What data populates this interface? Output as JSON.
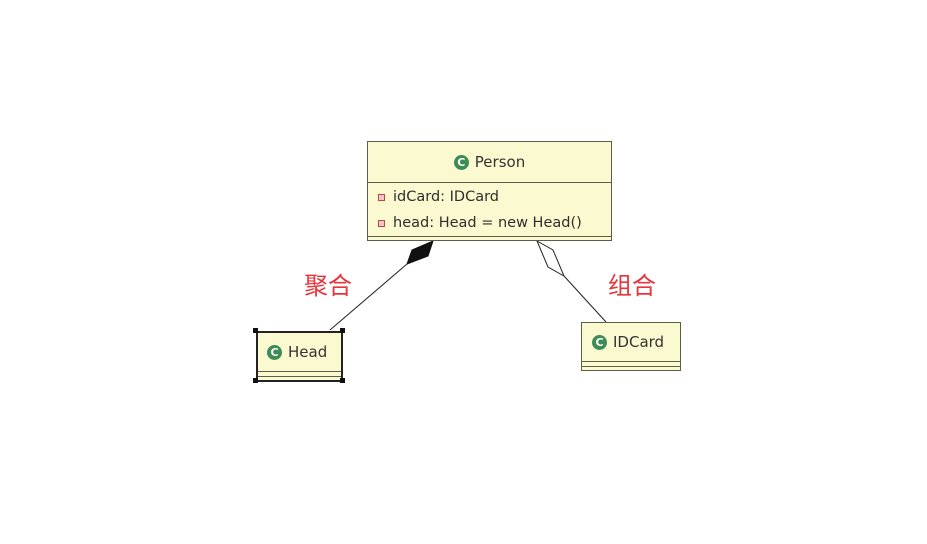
{
  "diagram": {
    "classes": {
      "person": {
        "name": "Person",
        "icon": "class-icon",
        "attributes": [
          {
            "text": "idCard: IDCard",
            "icon": "private-field-icon"
          },
          {
            "text": "head: Head = new Head()",
            "icon": "private-field-icon"
          }
        ]
      },
      "head": {
        "name": "Head",
        "icon": "class-icon"
      },
      "idcard": {
        "name": "IDCard",
        "icon": "class-icon"
      }
    },
    "relationships": [
      {
        "from": "person",
        "to": "head",
        "end": "filled-diamond",
        "label": "聚合"
      },
      {
        "from": "person",
        "to": "idcard",
        "end": "hollow-diamond",
        "label": "组合"
      }
    ],
    "colors": {
      "class_fill": "#fbf9cf",
      "class_border": "#5e5e48",
      "class_icon": "#3d8c56",
      "label_text": "#e8353b"
    }
  }
}
